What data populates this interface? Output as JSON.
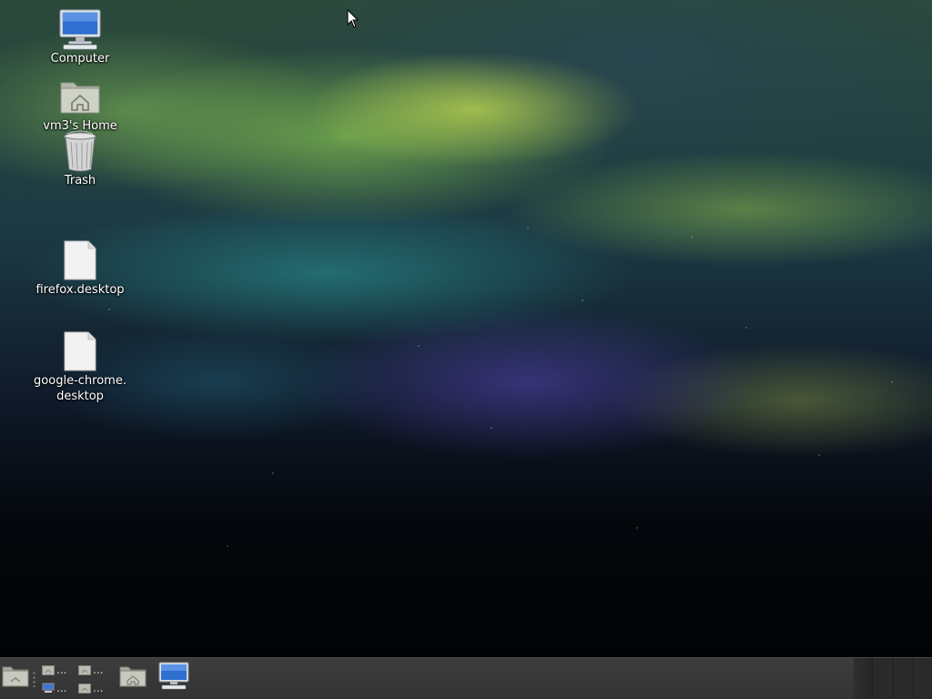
{
  "desktop": {
    "icons": [
      {
        "label": "Computer",
        "icon": "computer-icon"
      },
      {
        "label": "vm3's Home",
        "icon": "home-folder-icon"
      },
      {
        "label": "Trash",
        "icon": "trash-icon"
      },
      {
        "label": "firefox.desktop",
        "icon": "file-icon"
      },
      {
        "label": "google-chrome.\ndesktop",
        "icon": "file-icon"
      }
    ]
  },
  "panel": {
    "pager_ellipsis": "...",
    "launchers": [
      {
        "icon": "home-folder-icon"
      },
      {
        "icon": "computer-icon"
      }
    ]
  }
}
